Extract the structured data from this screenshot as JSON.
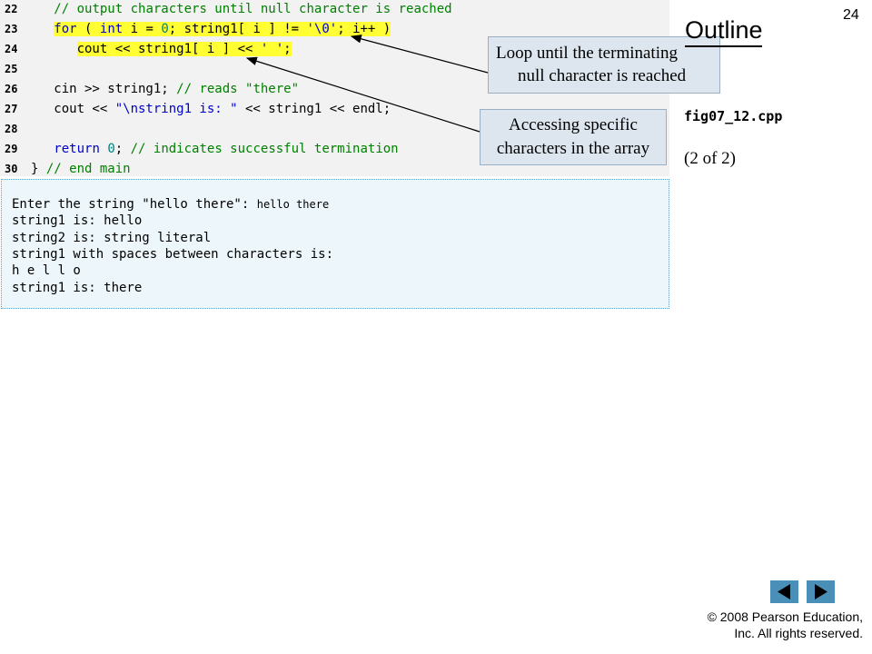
{
  "slide": {
    "number": "24",
    "outline_title": "Outline",
    "filename": "fig07_12.cpp",
    "page_info": "(2 of 2)"
  },
  "code_lines": [
    {
      "num": "22",
      "segments": [
        {
          "t": "   ",
          "c": ""
        },
        {
          "t": "// output characters until null character is reached",
          "c": "c-comment"
        }
      ]
    },
    {
      "num": "23",
      "segments": [
        {
          "t": "   ",
          "c": ""
        },
        {
          "t": "for",
          "c": "c-kw hl"
        },
        {
          "t": " ( ",
          "c": "hl"
        },
        {
          "t": "int",
          "c": "c-kw hl"
        },
        {
          "t": " i = ",
          "c": "hl"
        },
        {
          "t": "0",
          "c": "c-num hl"
        },
        {
          "t": "; string1[ i ] != ",
          "c": "hl"
        },
        {
          "t": "'\\0'",
          "c": "c-str hl"
        },
        {
          "t": "; i++ )",
          "c": "hl"
        }
      ]
    },
    {
      "num": "24",
      "segments": [
        {
          "t": "      ",
          "c": ""
        },
        {
          "t": "cout << string1[ i ] << ",
          "c": "hl"
        },
        {
          "t": "' '",
          "c": "c-str hl"
        },
        {
          "t": ";",
          "c": "hl"
        }
      ]
    },
    {
      "num": "25",
      "segments": [
        {
          "t": "",
          "c": ""
        }
      ]
    },
    {
      "num": "26",
      "segments": [
        {
          "t": "   cin >> string1; ",
          "c": ""
        },
        {
          "t": "// reads \"there\"",
          "c": "c-comment"
        }
      ]
    },
    {
      "num": "27",
      "segments": [
        {
          "t": "   cout << ",
          "c": ""
        },
        {
          "t": "\"\\nstring1 is: \"",
          "c": "c-str"
        },
        {
          "t": " << string1 << endl;",
          "c": ""
        }
      ]
    },
    {
      "num": "28",
      "segments": [
        {
          "t": "",
          "c": ""
        }
      ]
    },
    {
      "num": "29",
      "segments": [
        {
          "t": "   ",
          "c": ""
        },
        {
          "t": "return",
          "c": "c-kw"
        },
        {
          "t": " ",
          "c": ""
        },
        {
          "t": "0",
          "c": "c-num"
        },
        {
          "t": "; ",
          "c": ""
        },
        {
          "t": "// indicates successful termination",
          "c": "c-comment"
        }
      ]
    },
    {
      "num": "30",
      "segments": [
        {
          "t": "} ",
          "c": ""
        },
        {
          "t": "// end main",
          "c": "c-comment"
        }
      ]
    }
  ],
  "output": {
    "prompt": "Enter the string \"hello there\": ",
    "user_input": "hello there",
    "lines": [
      "string1 is: hello",
      "string2 is: string literal",
      "string1 with spaces between characters is:",
      "h e l l o",
      "string1 is: there"
    ]
  },
  "callouts": {
    "loop": {
      "line1": "Loop until the terminating",
      "line2": "null character is reached"
    },
    "access": {
      "line1": "Accessing specific",
      "line2": "characters in the array"
    }
  },
  "footer": {
    "copyright_line1": "© 2008 Pearson Education,",
    "copyright_line2": "Inc.  All rights reserved."
  },
  "colors": {
    "comment": "#008000",
    "keyword": "#0000cc",
    "highlight": "#ffff33",
    "nav_button": "#4a8fb8"
  },
  "icons": {
    "prev": "previous-slide-icon",
    "next": "next-slide-icon"
  }
}
